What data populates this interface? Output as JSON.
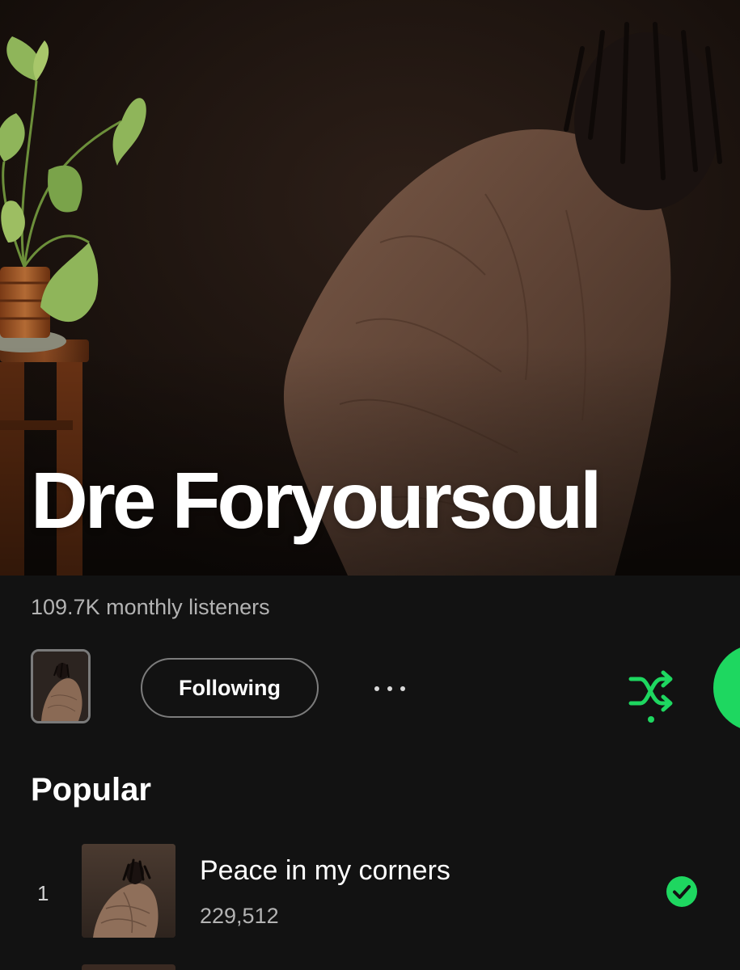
{
  "artist": {
    "name": "Dre Foryoursoul",
    "monthly_listeners": "109.7K monthly listeners"
  },
  "actions": {
    "follow_label": "Following"
  },
  "popular": {
    "heading": "Popular",
    "tracks": [
      {
        "rank": "1",
        "title": "Peace in my corners",
        "plays": "229,512",
        "saved": true
      }
    ]
  },
  "colors": {
    "background": "#121212",
    "accent": "#1ed760",
    "secondary_text": "#b3b3b3"
  },
  "icons": [
    "artist-cover-thumbnail",
    "more-options-icon",
    "shuffle-icon",
    "play-button",
    "saved-check-icon"
  ]
}
